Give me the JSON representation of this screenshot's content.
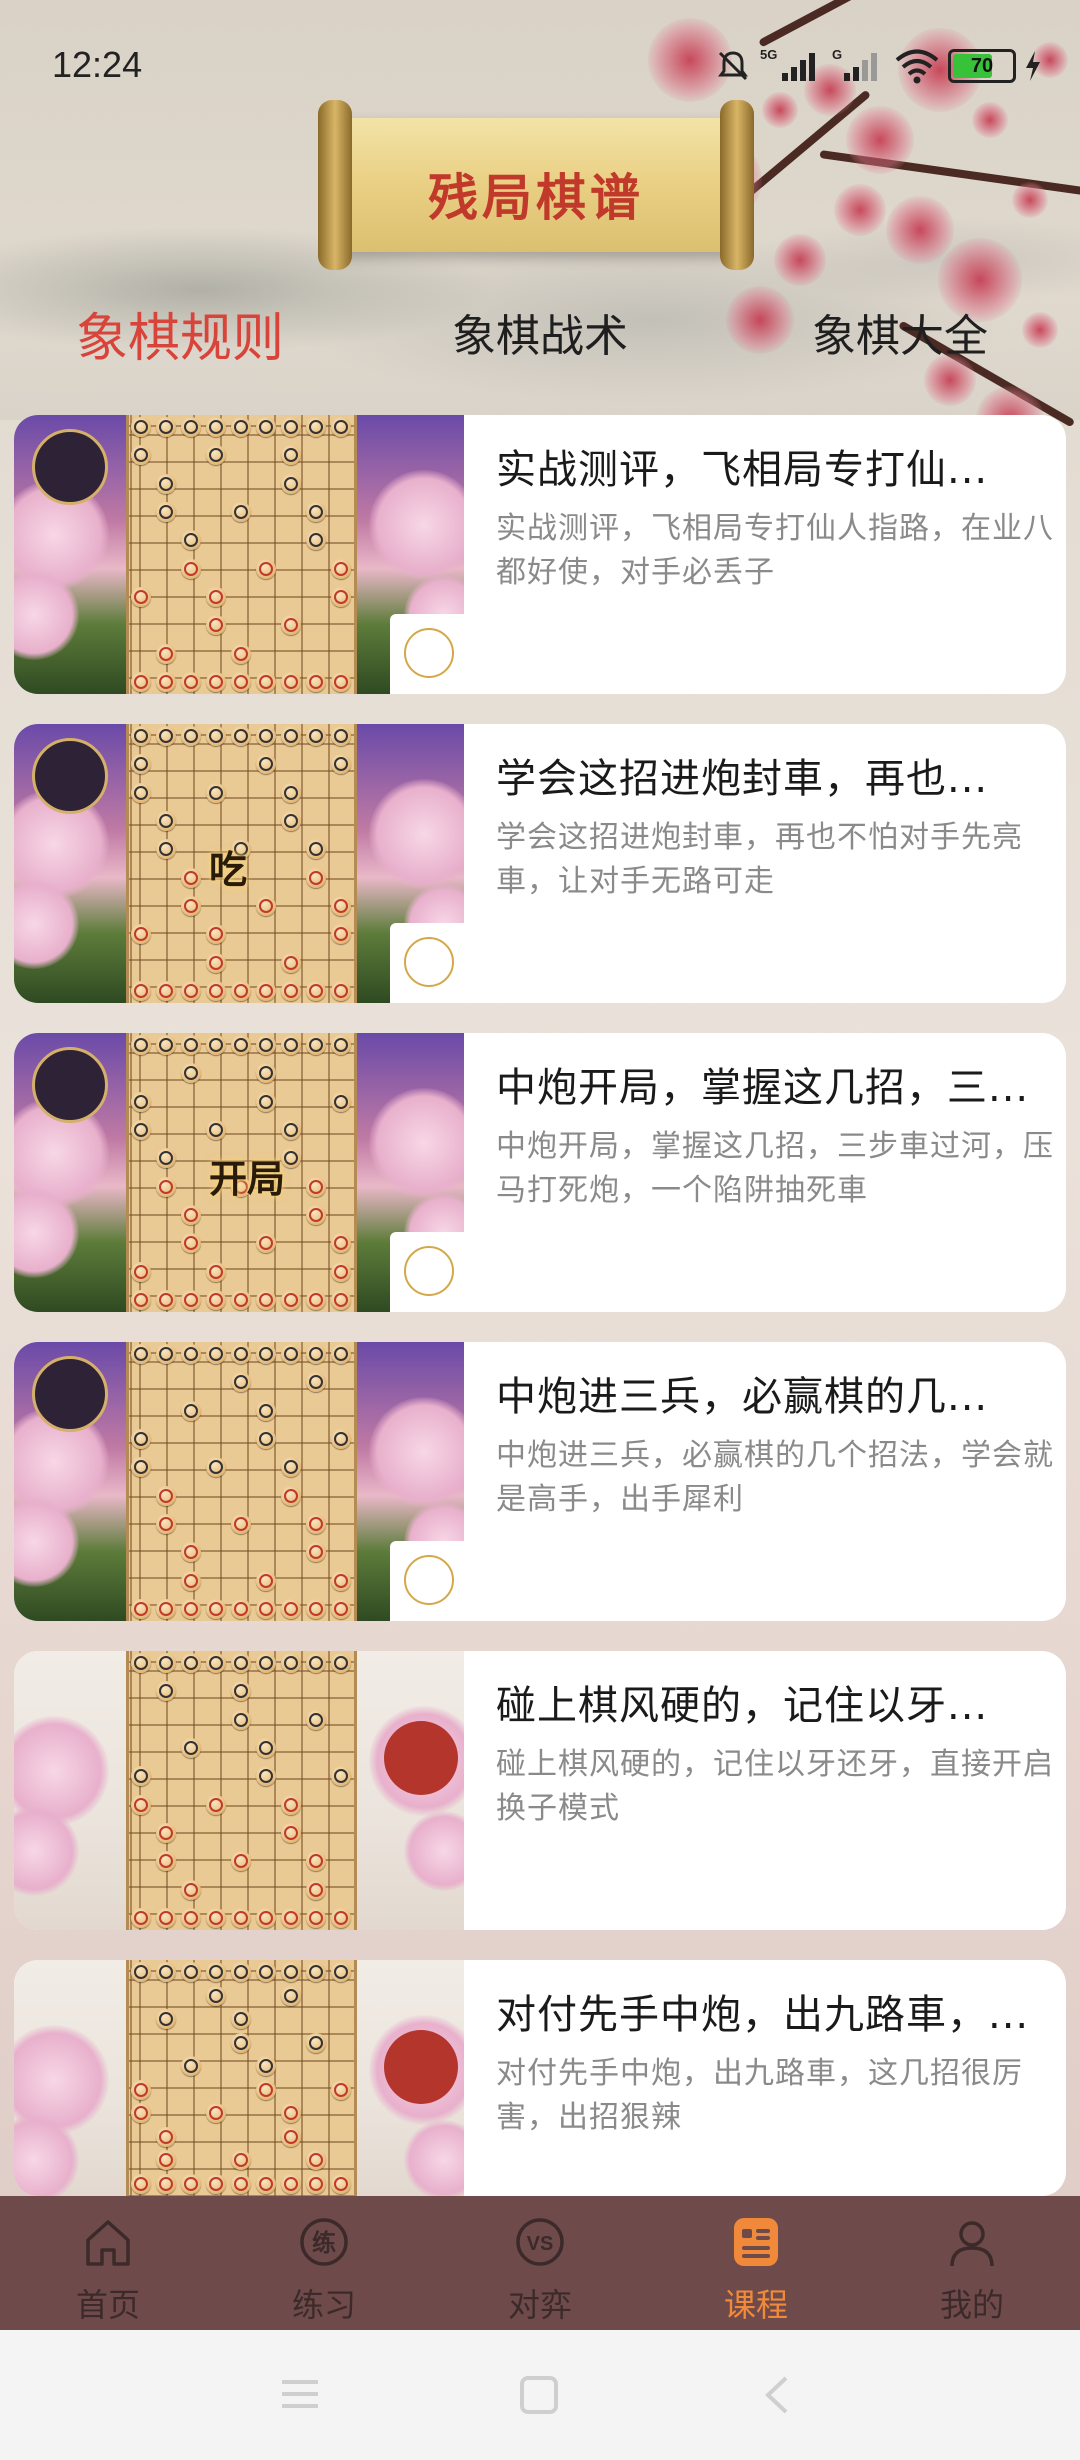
{
  "status_bar": {
    "time": "12:24",
    "network": "5G",
    "battery": "70",
    "icons": [
      "mute-bell-icon",
      "signal-5g-icon",
      "signal-g-icon",
      "wifi-icon",
      "battery-icon",
      "charging-icon"
    ]
  },
  "header": {
    "title": "残局棋谱"
  },
  "tabs": [
    {
      "label": "象棋规则",
      "active": true
    },
    {
      "label": "象棋战术",
      "active": false
    },
    {
      "label": "象棋大全",
      "active": false
    }
  ],
  "cards": [
    {
      "title": "实战测评，飞相局专打仙...",
      "desc": "实战测评，飞相局专打仙人指路，在业八都好使，对手必丢子",
      "thumb_style": "night",
      "overlay": ""
    },
    {
      "title": "学会这招进炮封車，再也...",
      "desc": "学会这招进炮封車，再也不怕对手先亮車，让对手无路可走",
      "thumb_style": "night",
      "overlay": "吃"
    },
    {
      "title": "中炮开局，掌握这几招，三...",
      "desc": "中炮开局，掌握这几招，三步車过河，压马打死炮，一个陷阱抽死車",
      "thumb_style": "night",
      "overlay": "开局"
    },
    {
      "title": "中炮进三兵，必赢棋的几...",
      "desc": "中炮进三兵，必赢棋的几个招法，学会就是高手，出手犀利",
      "thumb_style": "night",
      "overlay": ""
    },
    {
      "title": "碰上棋风硬的，记住以牙...",
      "desc": "碰上棋风硬的，记住以牙还牙，直接开启换子模式",
      "thumb_style": "light",
      "overlay": ""
    },
    {
      "title": "对付先手中炮，出九路車，...",
      "desc": "对付先手中炮，出九路車，这几招很厉害，出招狠辣",
      "thumb_style": "light",
      "overlay": ""
    }
  ],
  "bottom_nav": [
    {
      "label": "首页",
      "icon": "home-icon",
      "active": false
    },
    {
      "label": "练习",
      "icon": "practice-icon",
      "active": false
    },
    {
      "label": "对弈",
      "icon": "vs-icon",
      "active": false
    },
    {
      "label": "课程",
      "icon": "course-icon",
      "active": true
    },
    {
      "label": "我的",
      "icon": "profile-icon",
      "active": false
    }
  ],
  "system_nav": [
    "menu-icon",
    "home-square-icon",
    "back-icon"
  ],
  "colors": {
    "active_tab": "#d8443a",
    "nav_bg": "#6f4a4a",
    "nav_active": "#f08a3a",
    "title_red": "#c0392b"
  }
}
